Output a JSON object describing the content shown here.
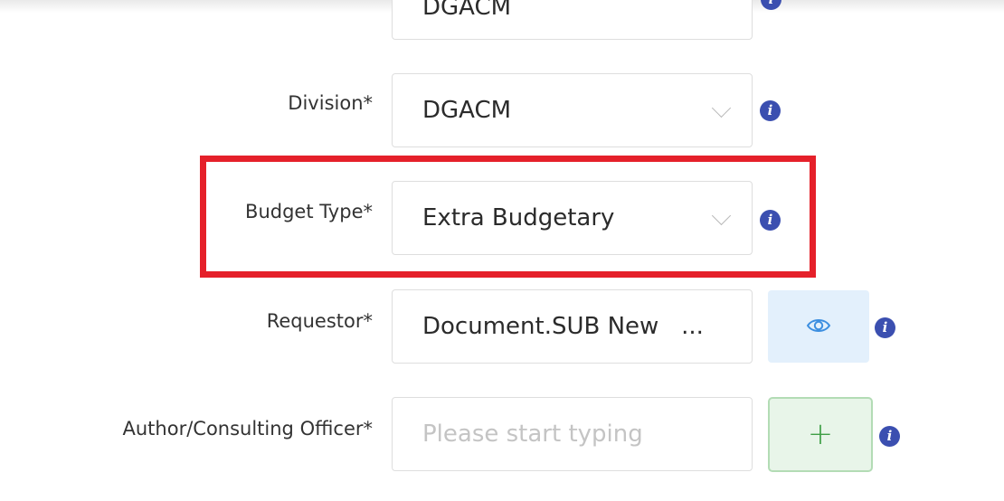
{
  "form": {
    "top_field": {
      "value": "DGACM"
    },
    "division": {
      "label": "Division*",
      "value": "DGACM"
    },
    "budget_type": {
      "label": "Budget Type*",
      "value": "Extra Budgetary"
    },
    "requestor": {
      "label": "Requestor*",
      "value": "Document.SUB New   ..."
    },
    "author": {
      "label": "Author/Consulting Officer*",
      "placeholder": "Please start typing",
      "value": ""
    }
  },
  "buttons": {
    "add_label": "+"
  },
  "icons": {
    "info": "info-icon",
    "chevron": "chevron-down-icon",
    "eye": "eye-icon",
    "plus": "plus-icon"
  },
  "colors": {
    "info_icon": "#3b4fb0",
    "highlight_border": "#e5202a",
    "view_button_bg": "#e3f0fc",
    "add_button_bg": "#e8f5e9",
    "add_button_fg": "#3f9f46"
  }
}
